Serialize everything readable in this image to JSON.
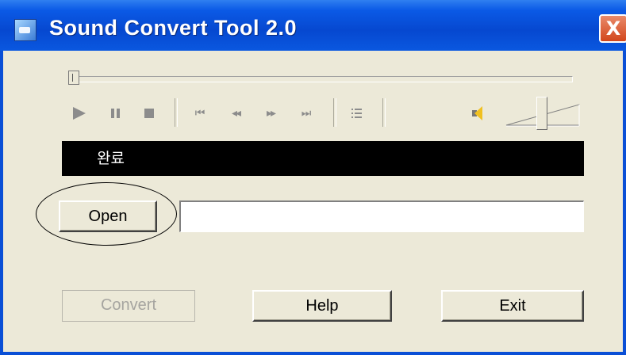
{
  "window": {
    "title": "Sound Convert Tool 2.0",
    "close_label": "X",
    "titlebar_color": "#0648d0",
    "client_color": "#ece9d8"
  },
  "player": {
    "controls": {
      "play": "play-icon",
      "pause": "pause-icon",
      "stop": "stop-icon",
      "skip_start": "⏮",
      "rewind": "◂◂",
      "fast_forward": "▸▸",
      "skip_end": "⏭",
      "playlist": "playlist-icon"
    },
    "volume_icon": "speaker-icon"
  },
  "status": {
    "text": "완료"
  },
  "file": {
    "open_label": "Open",
    "path_value": ""
  },
  "footer": {
    "convert_label": "Convert",
    "help_label": "Help",
    "exit_label": "Exit"
  }
}
